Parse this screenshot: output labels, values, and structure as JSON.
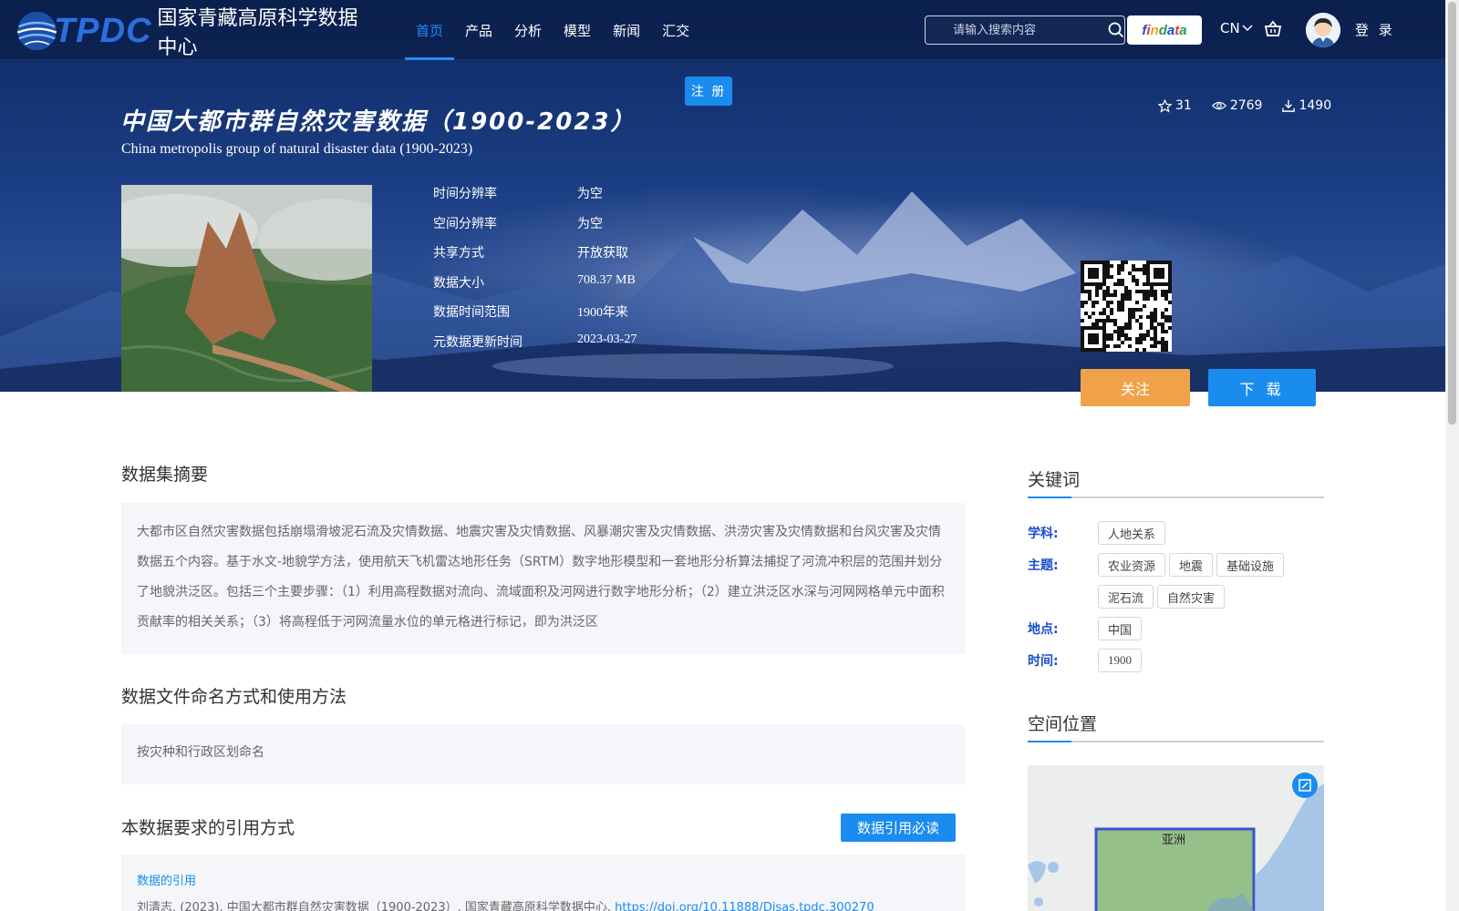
{
  "header": {
    "logo_text": "TPDC",
    "logo_name": "国家青藏高原科学数据中心",
    "nav": [
      {
        "label": "首页",
        "active": true
      },
      {
        "label": "产品",
        "active": false
      },
      {
        "label": "分析",
        "active": false
      },
      {
        "label": "模型",
        "active": false
      },
      {
        "label": "新闻",
        "active": false
      },
      {
        "label": "汇交",
        "active": false
      }
    ],
    "search_placeholder": "请输入搜索内容",
    "findata": {
      "letters": [
        "f",
        "i",
        "n",
        "d",
        "a",
        "t",
        "a"
      ],
      "colors": [
        "#1a4ec9",
        "#e03a3a",
        "#f0a020",
        "#2a9d4a",
        "#1a4ec9",
        "#e03a3a",
        "#2a9d4a"
      ]
    },
    "lang": "CN",
    "login": "登 录",
    "register": "注 册"
  },
  "dataset": {
    "title_cn": "中国大都市群自然灾害数据（1900-2023）",
    "title_en": "China metropolis group of natural disaster data (1900-2023)",
    "stats": {
      "favorites": "31",
      "views": "2769",
      "downloads": "1490"
    },
    "meta": [
      {
        "label": "时间分辨率",
        "value": "为空"
      },
      {
        "label": "空间分辨率",
        "value": "为空"
      },
      {
        "label": "共享方式",
        "value": "开放获取"
      },
      {
        "label": "数据大小",
        "value": "708.37 MB"
      },
      {
        "label": "数据时间范围",
        "value": "1900年来"
      },
      {
        "label": "元数据更新时间",
        "value": "2023-03-27"
      }
    ],
    "follow": "关注",
    "download": "下 载"
  },
  "abstract": {
    "title": "数据集摘要",
    "text": "大都市区自然灾害数据包括崩塌滑坡泥石流及灾情数据、地震灾害及灾情数据、风暴潮灾害及灾情数据、洪涝灾害及灾情数据和台风灾害及灾情数据五个内容。基于水文-地貌学方法，使用航天飞机雷达地形任务（SRTM）数字地形模型和一套地形分析算法捕捉了河流冲积层的范围并划分了地貌洪泛区。包括三个主要步骤：（1）利用高程数据对流向、流域面积及河网进行数字地形分析；（2）建立洪泛区水深与河网网格单元中面积贡献率的相关关系；（3）将高程低于河网流量水位的单元格进行标记，即为洪泛区"
  },
  "naming": {
    "title": "数据文件命名方式和使用方法",
    "text": "按灾种和行政区划命名"
  },
  "citation": {
    "title": "本数据要求的引用方式",
    "button": "数据引用必读",
    "label": "数据的引用",
    "text": "刘清志. (2023). 中国大都市群自然灾害数据（1900-2023）. 国家青藏高原科学数据中心.",
    "link": "https://doi.org/10.11888/Disas.tpdc.300270"
  },
  "keywords": {
    "title": "关键词",
    "groups": [
      {
        "label": "学科:",
        "tags": [
          "人地关系"
        ]
      },
      {
        "label": "主题:",
        "tags": [
          "农业资源",
          "地震",
          "基础设施",
          "泥石流",
          "自然灾害"
        ]
      },
      {
        "label": "地点:",
        "tags": [
          "中国"
        ]
      },
      {
        "label": "时间:",
        "tags": [
          "1900"
        ]
      }
    ]
  },
  "location": {
    "title": "空间位置",
    "map_label": "亚洲"
  }
}
